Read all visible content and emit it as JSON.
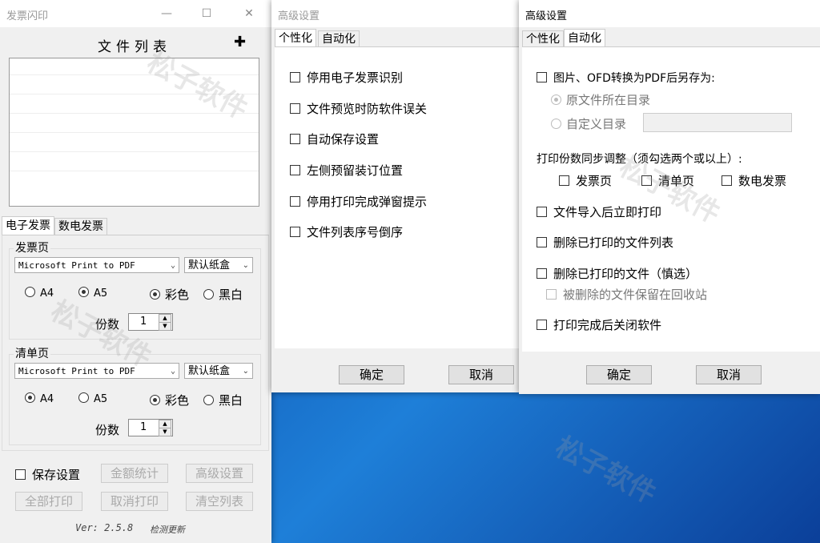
{
  "main_window": {
    "title": "发票闪印",
    "file_list_title": "文件列表",
    "tabs": [
      "电子发票",
      "数电发票"
    ],
    "invoice_group": {
      "title": "发票页",
      "printer": "Microsoft Print to PDF",
      "tray": "默认纸盒",
      "size_a4": "A4",
      "size_a5": "A5",
      "color": "彩色",
      "bw": "黑白",
      "copies_label": "份数",
      "copies": "1"
    },
    "list_group": {
      "title": "清单页",
      "printer": "Microsoft Print to PDF",
      "tray": "默认纸盒",
      "size_a4": "A4",
      "size_a5": "A5",
      "color": "彩色",
      "bw": "黑白",
      "copies_label": "份数",
      "copies": "1"
    },
    "save_settings": "保存设置",
    "buttons": {
      "amount_stats": "金额统计",
      "advanced": "高级设置",
      "print_all": "全部打印",
      "cancel_print": "取消打印",
      "clear_list": "清空列表"
    },
    "version": "Ver: 2.5.8",
    "check_update": "检测更新"
  },
  "dialog_personalize": {
    "title": "高级设置",
    "tabs": [
      "个性化",
      "自动化"
    ],
    "options": [
      "停用电子发票识别",
      "文件预览时防软件误关",
      "自动保存设置",
      "左侧预留装订位置",
      "停用打印完成弹窗提示",
      "文件列表序号倒序"
    ],
    "ok": "确定",
    "cancel": "取消"
  },
  "dialog_automation": {
    "title": "高级设置",
    "tabs": [
      "个性化",
      "自动化"
    ],
    "save_as": "图片、OFD转换为PDF后另存为:",
    "save_as_options": [
      "原文件所在目录",
      "自定义目录"
    ],
    "sync_label": "打印份数同步调整（须勾选两个或以上）:",
    "sync_options": [
      "发票页",
      "清单页",
      "数电发票"
    ],
    "options": [
      "文件导入后立即打印",
      "删除已打印的文件列表",
      "删除已打印的文件（慎选）"
    ],
    "recycle_option": "被删除的文件保留在回收站",
    "close_option": "打印完成后关闭软件",
    "ok": "确定",
    "cancel": "取消"
  },
  "watermark": "松子软件"
}
